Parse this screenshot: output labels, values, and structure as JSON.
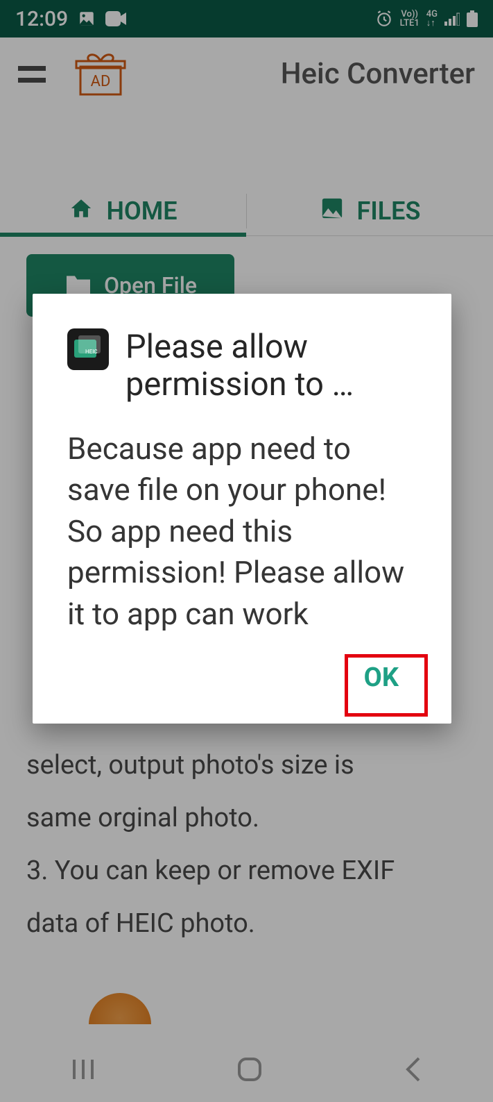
{
  "status": {
    "time": "12:09"
  },
  "header": {
    "title": "Heic Converter",
    "ad_label": "AD"
  },
  "tabs": {
    "home": "HOME",
    "files": "FILES"
  },
  "open_button": {
    "label": "Open File"
  },
  "desc": {
    "line_visible_1": "select, output photo's size is",
    "line_visible_2": "same orginal photo.",
    "line_visible_3": "3. You can keep or remove EXIF",
    "line_visible_4": "data of HEIC photo."
  },
  "dialog": {
    "title": "Please allow permission to …",
    "body": "Because app need to save file on your phone! So app need this permission! Please allow it to app can work",
    "ok": "OK"
  }
}
